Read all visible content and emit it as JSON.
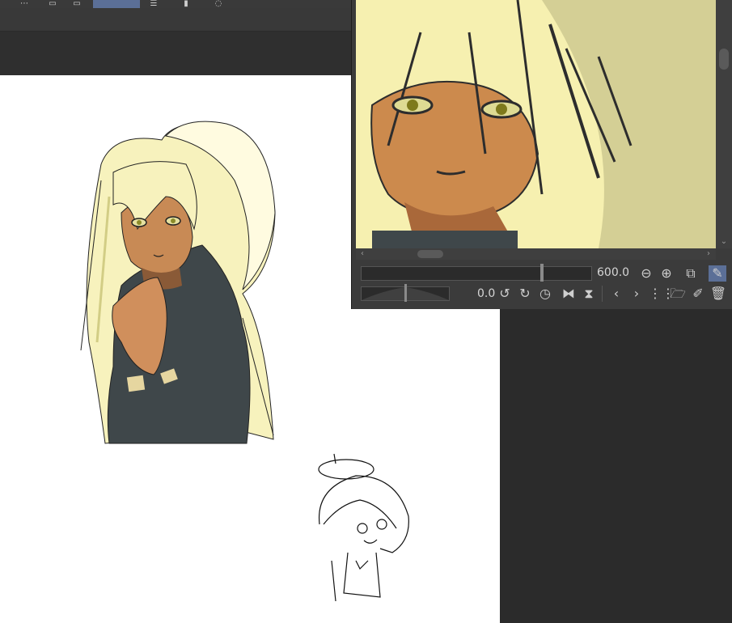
{
  "navigator": {
    "zoom_value": "600.0",
    "zoom_fraction": 0.79,
    "rotation_value": "0.0",
    "rotation_fraction": 0.5
  },
  "icons": {
    "zoom_out": "minus-circle-icon",
    "zoom_in": "plus-circle-icon",
    "fit": "fit-window-icon",
    "eyedropper": "eyedropper-icon",
    "rotate_left": "rotate-left-icon",
    "rotate_right": "rotate-right-icon",
    "reset_rotation": "reset-rotation-icon",
    "flip_h": "flip-horizontal-icon",
    "flip_v": "flip-vertical-icon",
    "prev": "chevron-left-icon",
    "next": "chevron-right-icon",
    "grid": "grid-icon",
    "folder": "folder-icon",
    "edit": "edit-icon",
    "trash": "trash-icon"
  },
  "colors": {
    "panel_bg": "#3b3b3b",
    "canvas_bg": "#ffffff",
    "active_button": "#5b6f97"
  }
}
